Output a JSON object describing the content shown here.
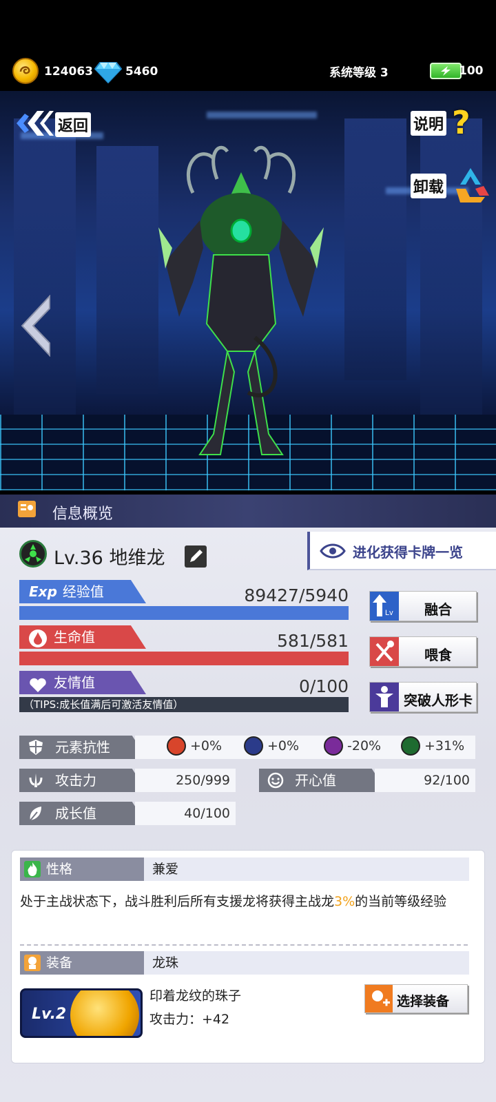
{
  "resources": {
    "coins": "124063",
    "gems": "5460",
    "system_level": "系统等级 3",
    "energy": "100"
  },
  "nav": {
    "back_label": "返回",
    "help_label": "说明",
    "unload_label": "卸载"
  },
  "info": {
    "header": "信息概览"
  },
  "pet": {
    "name": "Lv.36 地维龙"
  },
  "evolve_button": "进化获得卡牌一览",
  "stats": {
    "exp": {
      "label": "经验值",
      "value": "89427/5940",
      "fill": 1.0,
      "color": "#4a78d8"
    },
    "hp": {
      "label": "生命值",
      "value": "581/581",
      "fill": 1.0,
      "color": "#d94848"
    },
    "friend": {
      "label": "友情值",
      "value": "0/100",
      "fill": 0.0,
      "color": "#6a55b0",
      "tips": "（TIPS:成长值满后可激活友情值）"
    }
  },
  "actions": {
    "fuse": "融合",
    "feed": "喂食",
    "breakthrough": "突破人形卡"
  },
  "attributes": {
    "resistance_label": "元素抗性",
    "resistances": [
      {
        "icon": "fire-element-icon",
        "value": "+0%",
        "color": "#d8452b"
      },
      {
        "icon": "water-element-icon",
        "value": "+0%",
        "color": "#2b3b8a"
      },
      {
        "icon": "thunder-element-icon",
        "value": "-20%",
        "color": "#7a2b9a"
      },
      {
        "icon": "earth-element-icon",
        "value": "+31%",
        "color": "#1e6b30"
      }
    ],
    "attack_label": "攻击力",
    "attack_value": "250/999",
    "happy_label": "开心值",
    "happy_value": "92/100",
    "growth_label": "成长值",
    "growth_value": "40/100"
  },
  "personality": {
    "label": "性格",
    "value": "兼爱",
    "desc_prefix": "处于主战状态下，战斗胜利后所有支援龙将获得主战龙",
    "desc_highlight": "3%",
    "desc_suffix": "的当前等级经验"
  },
  "equipment": {
    "label": "装备",
    "value": "龙珠",
    "level": "Lv.2",
    "name": "印着龙纹的珠子",
    "attack": "攻击力：+42",
    "choose_button": "选择装备"
  }
}
